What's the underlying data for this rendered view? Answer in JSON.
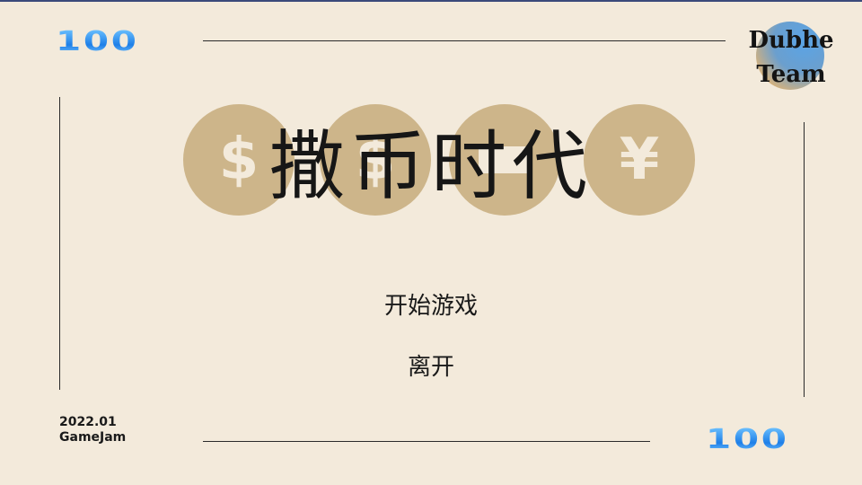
{
  "decor": {
    "top_number": "100",
    "bottom_number": "100"
  },
  "team": {
    "line1": "Dubhe",
    "line2": "Team"
  },
  "coins": [
    "$",
    "$",
    "",
    "¥"
  ],
  "game": {
    "title": "撒币时代"
  },
  "menu": {
    "start_label": "开始游戏",
    "quit_label": "离开"
  },
  "credit": {
    "date": "2022.01",
    "event": "GameJam"
  },
  "colors": {
    "background": "#f3eadb",
    "coin": "#cdb58a",
    "accent_blue": "#1e7fe8"
  }
}
